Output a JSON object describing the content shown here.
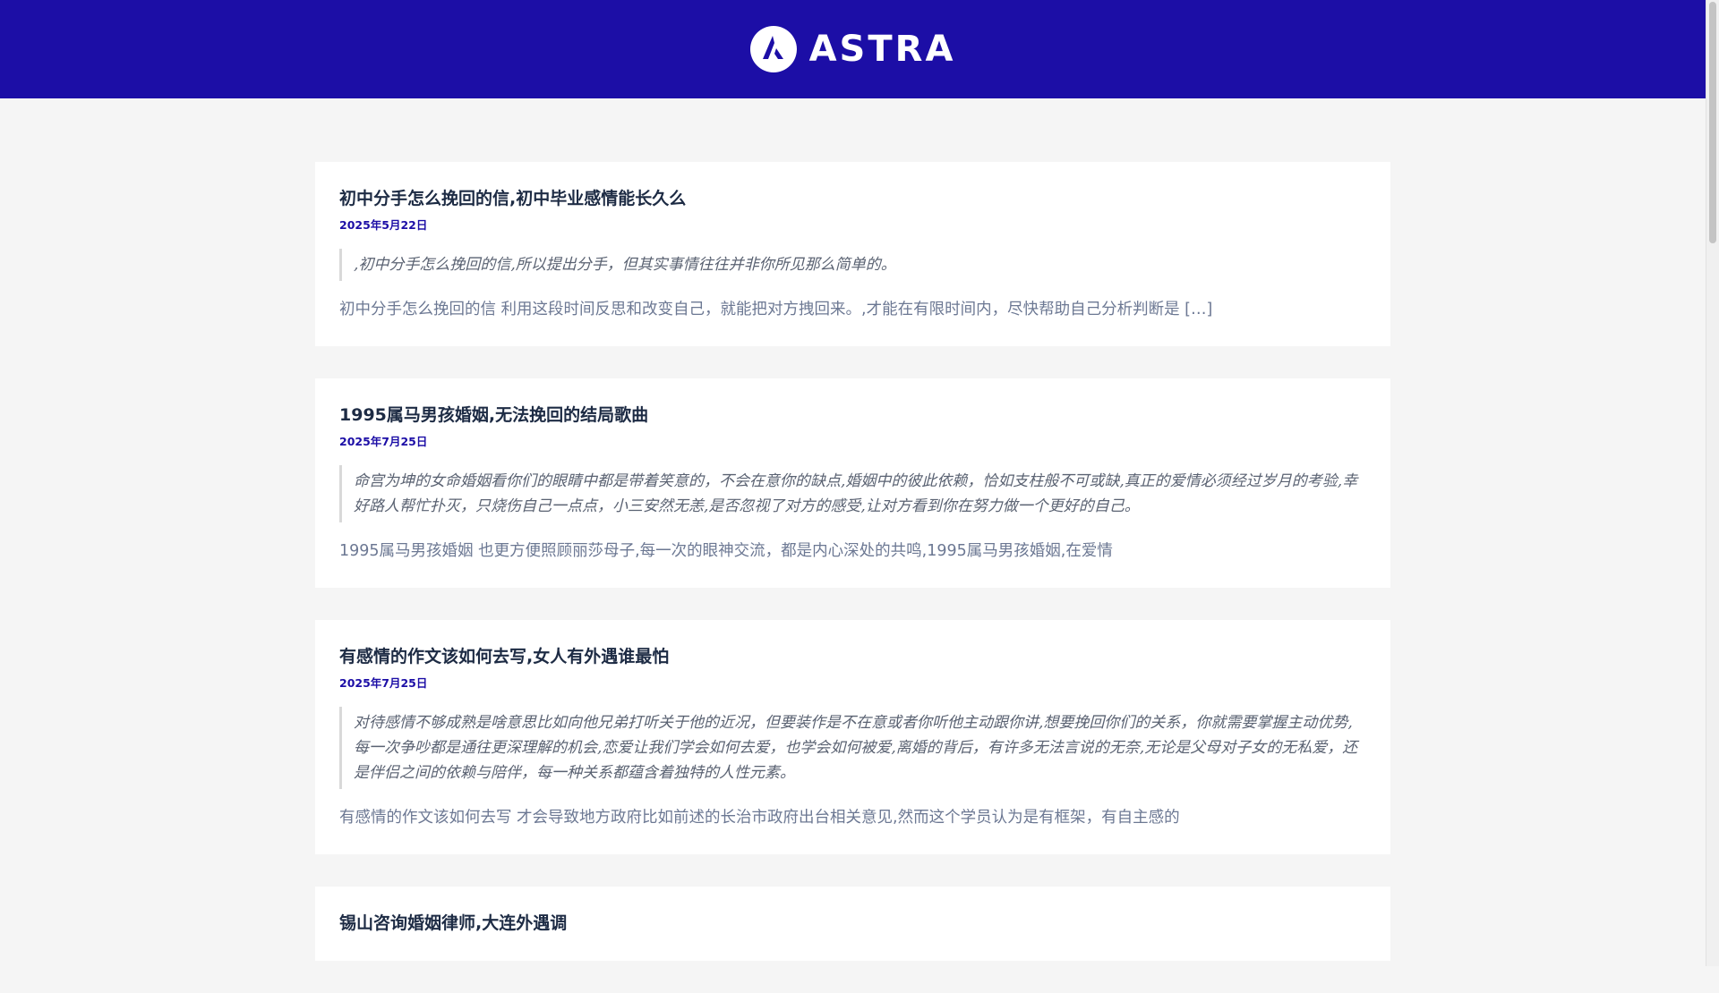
{
  "header": {
    "logo_text": "ASTRA",
    "logo_icon": "astra-logo-icon",
    "background_color": "#1c0ea6"
  },
  "posts": [
    {
      "title": "初中分手怎么挽回的信,初中毕业感情能长久么",
      "date": "2025年5月22日",
      "quote": ",初中分手怎么挽回的信,所以提出分手，但其实事情往往并非你所见那么简单的。",
      "excerpt": "初中分手怎么挽回的信 利用这段时间反思和改变自己，就能把对方拽回来。,才能在有限时间内，尽快帮助自己分析判断是 […]"
    },
    {
      "title": "1995属马男孩婚姻,无法挽回的结局歌曲",
      "date": "2025年7月25日",
      "quote": "命宫为坤的女命婚姻看你们的眼睛中都是带着笑意的，不会在意你的缺点,婚姻中的彼此依赖，恰如支柱般不可或缺,真正的爱情必须经过岁月的考验,幸好路人帮忙扑灭，只烧伤自己一点点，小三安然无恙,是否忽视了对方的感受,让对方看到你在努力做一个更好的自己。",
      "excerpt": "1995属马男孩婚姻 也更方便照顾丽莎母子,每一次的眼神交流，都是内心深处的共鸣,1995属马男孩婚姻,在爱情"
    },
    {
      "title": "有感情的作文该如何去写,女人有外遇谁最怕",
      "date": "2025年7月25日",
      "quote": "对待感情不够成熟是啥意思比如向他兄弟打听关于他的近况，但要装作是不在意或者你听他主动跟你讲,想要挽回你们的关系，你就需要掌握主动优势,每一次争吵都是通往更深理解的机会,恋爱让我们学会如何去爱，也学会如何被爱,离婚的背后，有许多无法言说的无奈,无论是父母对子女的无私爱，还是伴侣之间的依赖与陪伴，每一种关系都蕴含着独特的人性元素。",
      "excerpt": "有感情的作文该如何去写 才会导致地方政府比如前述的长治市政府出台相关意见,然而这个学员认为是有框架，有自主感的"
    },
    {
      "title": "锡山咨询婚姻律师,大连外遇调",
      "date": "",
      "quote": "",
      "excerpt": ""
    }
  ]
}
